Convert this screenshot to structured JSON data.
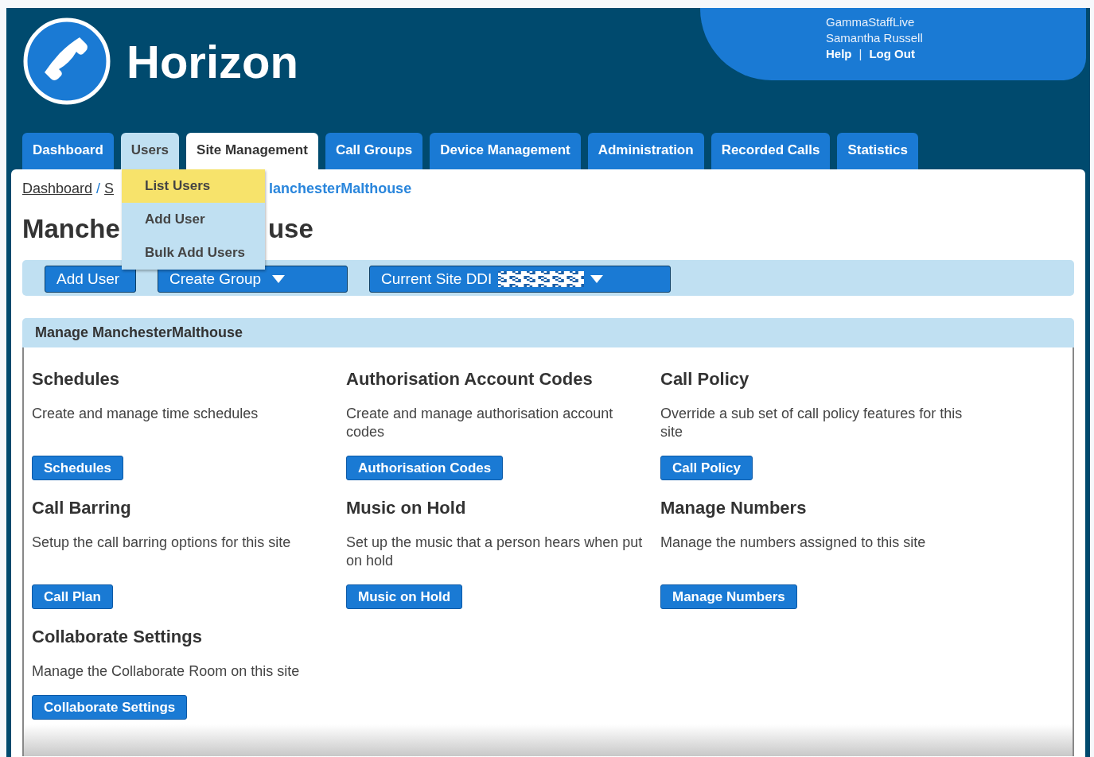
{
  "header": {
    "logo_text": "Horizon",
    "account": "GammaStaffLive",
    "user": "Samantha Russell",
    "links": [
      "Help",
      "Log Out"
    ],
    "link_separator": "|"
  },
  "tabs": [
    {
      "label": "Dashboard",
      "selected": false,
      "open": false
    },
    {
      "label": "Users",
      "selected": false,
      "open": true
    },
    {
      "label": "Site Management",
      "selected": true,
      "open": false
    },
    {
      "label": "Call Groups",
      "selected": false,
      "open": false
    },
    {
      "label": "Device Management",
      "selected": false,
      "open": false
    },
    {
      "label": "Administration",
      "selected": false,
      "open": false
    },
    {
      "label": "Recorded Calls",
      "selected": false,
      "open": false
    },
    {
      "label": "Statistics",
      "selected": false,
      "open": false
    }
  ],
  "users_menu": [
    {
      "label": "List Users",
      "selected": true
    },
    {
      "label": "Add User",
      "selected": false
    },
    {
      "label": "Bulk Add Users",
      "selected": false
    }
  ],
  "breadcrumb": [
    {
      "text": "Dashboard",
      "kind": "link"
    },
    {
      "text": "/",
      "kind": "separator"
    },
    {
      "text": "S",
      "kind": "link"
    },
    {
      "text": "lanchesterMalthouse",
      "kind": "current"
    }
  ],
  "title": [
    "Manche",
    "use"
  ],
  "toolbar": [
    {
      "label": "Add User",
      "dropdown": false,
      "redacted": false
    },
    {
      "label": "Create Group",
      "dropdown": true,
      "redacted": false
    },
    {
      "label": "Current Site DDI",
      "dropdown": true,
      "redacted": true
    }
  ],
  "panel": {
    "title": "Manage ManchesterMalthouse",
    "sections": [
      {
        "title": "Schedules",
        "description": "Create and manage time schedules",
        "button": "Schedules"
      },
      {
        "title": "Authorisation Account Codes",
        "description": "Create and manage authorisation account codes",
        "button": "Authorisation Codes"
      },
      {
        "title": "Call Policy",
        "description": "Override a sub set of call policy features for this site",
        "button": "Call Policy"
      },
      {
        "title": "Call Barring",
        "description": "Setup the call barring options for this site",
        "button": "Call Plan"
      },
      {
        "title": "Music on Hold",
        "description": "Set up the music that a person hears when put on hold",
        "button": "Music on Hold"
      },
      {
        "title": "Manage Numbers",
        "description": "Manage the numbers assigned to this site",
        "button": "Manage Numbers"
      },
      {
        "title": "Collaborate Settings",
        "description": "Manage the Collaborate Room on this site",
        "button": "Collaborate Settings"
      }
    ]
  }
}
